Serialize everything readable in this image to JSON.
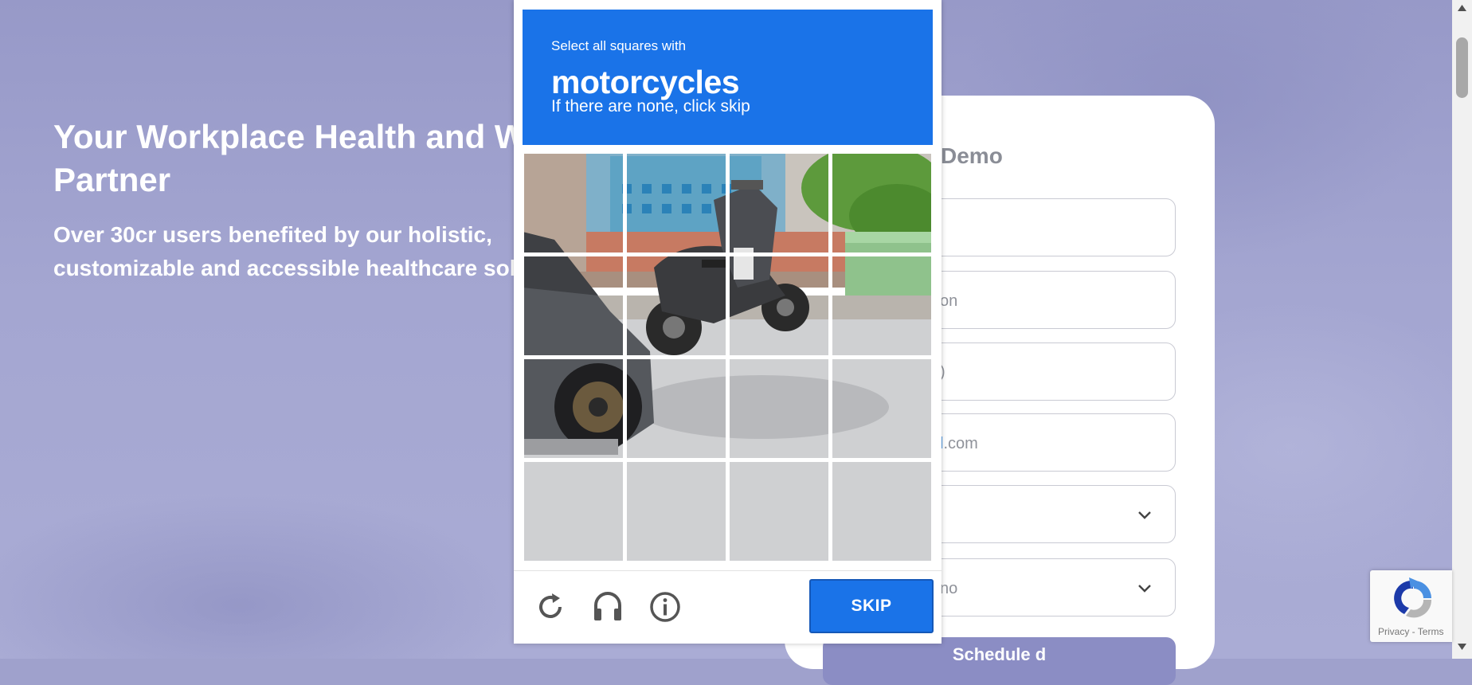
{
  "hero": {
    "title_line1": "Your Workplace Health and Wellness",
    "title_line2": "Partner",
    "subtitle_line1": "Over 30cr users benefited by our holistic,",
    "subtitle_line2": "customizable and accessible healthcare solutions"
  },
  "form": {
    "heading_visible": "Demo",
    "fields": [
      {
        "visible_text": ""
      },
      {
        "visible_text": "on"
      },
      {
        "visible_text": ")"
      },
      {
        "visible_text_blue": "l",
        "visible_text": ".com"
      },
      {
        "visible_text": "",
        "type": "select"
      },
      {
        "visible_text": "no",
        "type": "select"
      }
    ],
    "submit_visible": "Schedule d"
  },
  "captcha": {
    "instruction": "Select all squares with",
    "target": "motorcycles",
    "hint": "If there are none, click skip",
    "grid_rows": 4,
    "grid_cols": 4,
    "skip_label": "SKIP",
    "icons": [
      "reload-icon",
      "audio-icon",
      "info-icon"
    ],
    "accent_color": "#1a73e8"
  },
  "recaptcha_badge": {
    "terms": "Privacy - Terms"
  },
  "colors": {
    "background": "#9fa1cc",
    "card": "#ffffff",
    "captcha_blue": "#1a73e8"
  }
}
